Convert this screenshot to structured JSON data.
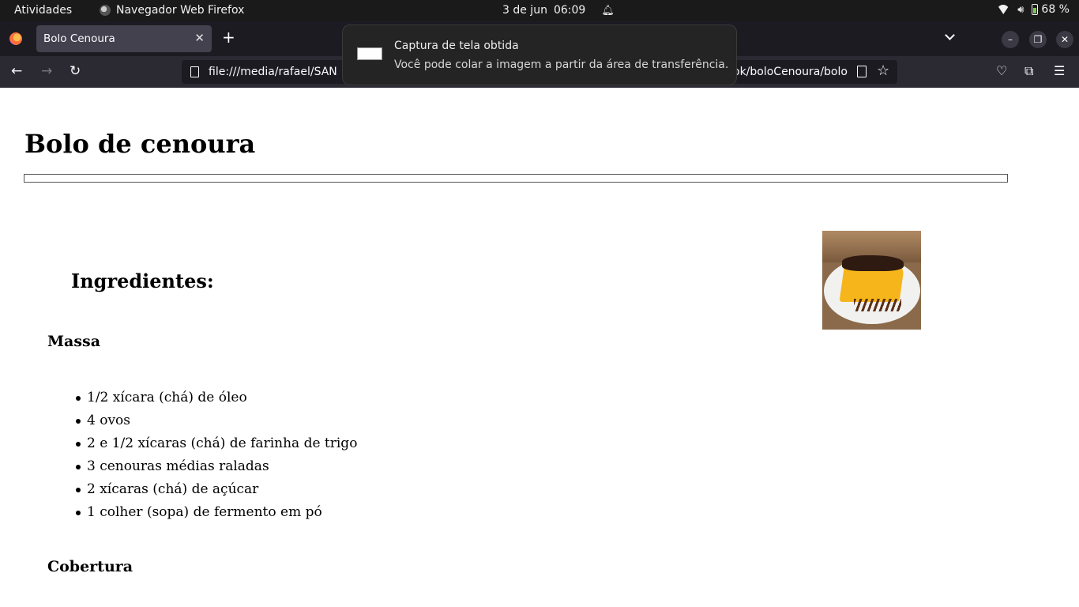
{
  "topbar": {
    "activities": "Atividades",
    "app_name": "Navegador Web Firefox",
    "date": "3 de jun",
    "time": "06:09",
    "battery": "68 %"
  },
  "browser": {
    "tab_title": "Bolo Cenoura",
    "url_start": "file:///media/rafael/SAN",
    "url_end": "ok/boloCenoura/bolo"
  },
  "notification": {
    "title": "Captura de tela obtida",
    "body": "Você pode colar a imagem a partir da área de transferência."
  },
  "page": {
    "title": "Bolo de cenoura",
    "section_heading": "Ingredientes:",
    "massa_heading": "Massa",
    "massa_items": [
      "1/2 xícara (chá) de óleo",
      "4 ovos",
      "2 e 1/2 xícaras (chá) de farinha de trigo",
      "3 cenouras médias raladas",
      "2 xícaras (chá) de açúcar",
      "1 colher (sopa) de fermento em pó"
    ],
    "cobertura_heading": "Cobertura"
  },
  "colors": {
    "topbar_bg": "#1a1a1a",
    "tabbar_bg": "#1c1b22",
    "navbar_bg": "#2b2a33",
    "active_tab": "#42414d",
    "notification_bg": "#242424"
  }
}
